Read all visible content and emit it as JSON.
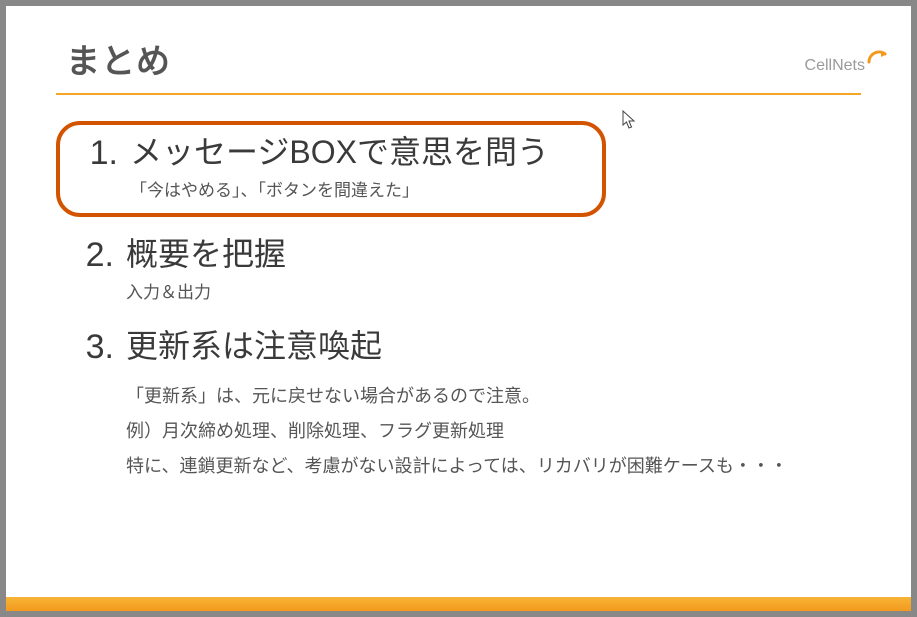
{
  "page": {
    "title": "まとめ",
    "logo_text": "CellNets"
  },
  "items": [
    {
      "num": "1.",
      "heading": "メッセージBOXで意思を問う",
      "sub": "「今はやめる」、「ボタンを間違えた」",
      "highlighted": true
    },
    {
      "num": "2.",
      "heading": "概要を把握",
      "sub": "入力＆出力",
      "highlighted": false
    },
    {
      "num": "3.",
      "heading": "更新系は注意喚起",
      "detail_lines": [
        "「更新系」は、元に戻せない場合があるので注意。",
        "例）月次締め処理、削除処理、フラグ更新処理",
        "特に、連鎖更新など、考慮がない設計によっては、リカバリが困難ケースも・・・"
      ],
      "highlighted": false
    }
  ],
  "colors": {
    "accent": "#f5a623",
    "highlight_border": "#d35400"
  }
}
